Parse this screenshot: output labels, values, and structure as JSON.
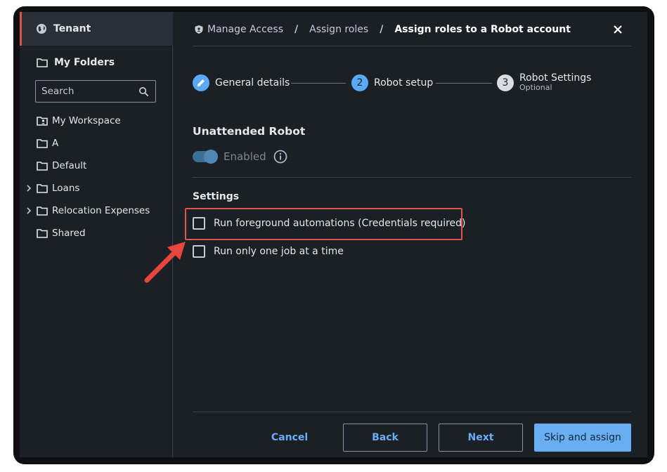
{
  "sidebar": {
    "tenant_label": "Tenant",
    "folders_title": "My Folders",
    "search_placeholder": "Search",
    "items": [
      {
        "label": "My Workspace",
        "expandable": false,
        "icon": "folder-user-icon"
      },
      {
        "label": "A",
        "expandable": false,
        "icon": "folder-icon"
      },
      {
        "label": "Default",
        "expandable": false,
        "icon": "folder-icon"
      },
      {
        "label": "Loans",
        "expandable": true,
        "icon": "folder-icon"
      },
      {
        "label": "Relocation Expenses",
        "expandable": true,
        "icon": "folder-icon"
      },
      {
        "label": "Shared",
        "expandable": false,
        "icon": "folder-icon"
      }
    ]
  },
  "breadcrumb": {
    "root": "Manage Access",
    "sep": "/",
    "middle": "Assign roles",
    "current": "Assign roles to a Robot account"
  },
  "stepper": {
    "steps": [
      {
        "number": "",
        "label": "General details",
        "sublabel": "",
        "state": "done"
      },
      {
        "number": "2",
        "label": "Robot setup",
        "sublabel": "",
        "state": "active"
      },
      {
        "number": "3",
        "label": "Robot Settings",
        "sublabel": "Optional",
        "state": "pending"
      }
    ]
  },
  "unattended": {
    "title": "Unattended Robot",
    "toggle_label": "Enabled",
    "enabled": true
  },
  "settings": {
    "title": "Settings",
    "options": [
      {
        "label": "Run foreground automations (Credentials required)",
        "checked": false
      },
      {
        "label": "Run only one job at a time",
        "checked": false
      }
    ]
  },
  "footer": {
    "cancel": "Cancel",
    "back": "Back",
    "next": "Next",
    "skip": "Skip and assign"
  },
  "colors": {
    "accent": "#5aa9f5",
    "highlight": "#e0544a",
    "background": "#1b2026"
  }
}
